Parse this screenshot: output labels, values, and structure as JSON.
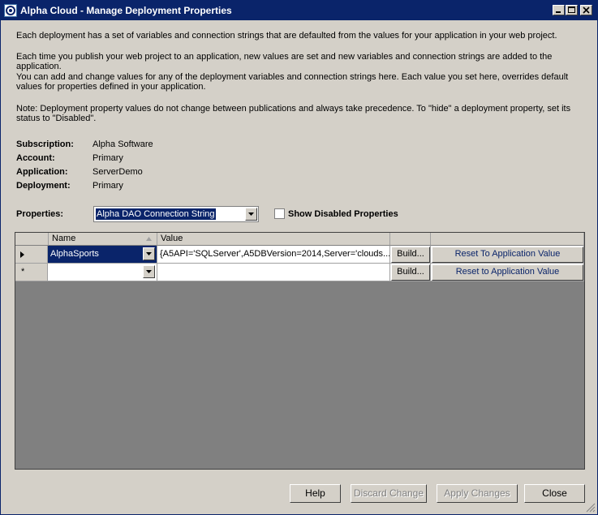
{
  "window": {
    "title": "Alpha Cloud - Manage Deployment Properties"
  },
  "description": [
    "Each deployment has a set of variables and connection strings that are defaulted from the values for your application in your web project.",
    "Each time you publish your web project to an application, new values are set and new variables and connection strings are added to the application.",
    "You can add and change values for any of the deployment variables and connection strings here. Each value you set here, overrides default values for properties defined in your application.",
    "Note: Deployment property values do not change between publications and always take precedence.  To \"hide\" a deployment property, set its status to \"Disabled\"."
  ],
  "info": [
    {
      "label": "Subscription:",
      "value": "Alpha Software"
    },
    {
      "label": "Account:",
      "value": "Primary"
    },
    {
      "label": "Application:",
      "value": "ServerDemo"
    },
    {
      "label": "Deployment:",
      "value": "Primary"
    }
  ],
  "properties": {
    "label": "Properties:",
    "selected": "Alpha DAO Connection String"
  },
  "show_disabled": {
    "label": "Show Disabled Properties",
    "checked": false
  },
  "grid": {
    "columns": [
      "Name",
      "Value"
    ],
    "rows": [
      {
        "name": "AlphaSports",
        "value": "{A5API='SQLServer',A5DBVersion=2014,Server='clouds...",
        "build": "Build...",
        "reset": "Reset To Application Value",
        "current": true
      },
      {
        "name": "",
        "value": "",
        "build": "Build...",
        "reset": "Reset to Application Value",
        "marker": "*"
      }
    ]
  },
  "buttons": {
    "help": "Help",
    "discard": "Discard Change",
    "apply": "Apply Changes",
    "close": "Close"
  }
}
